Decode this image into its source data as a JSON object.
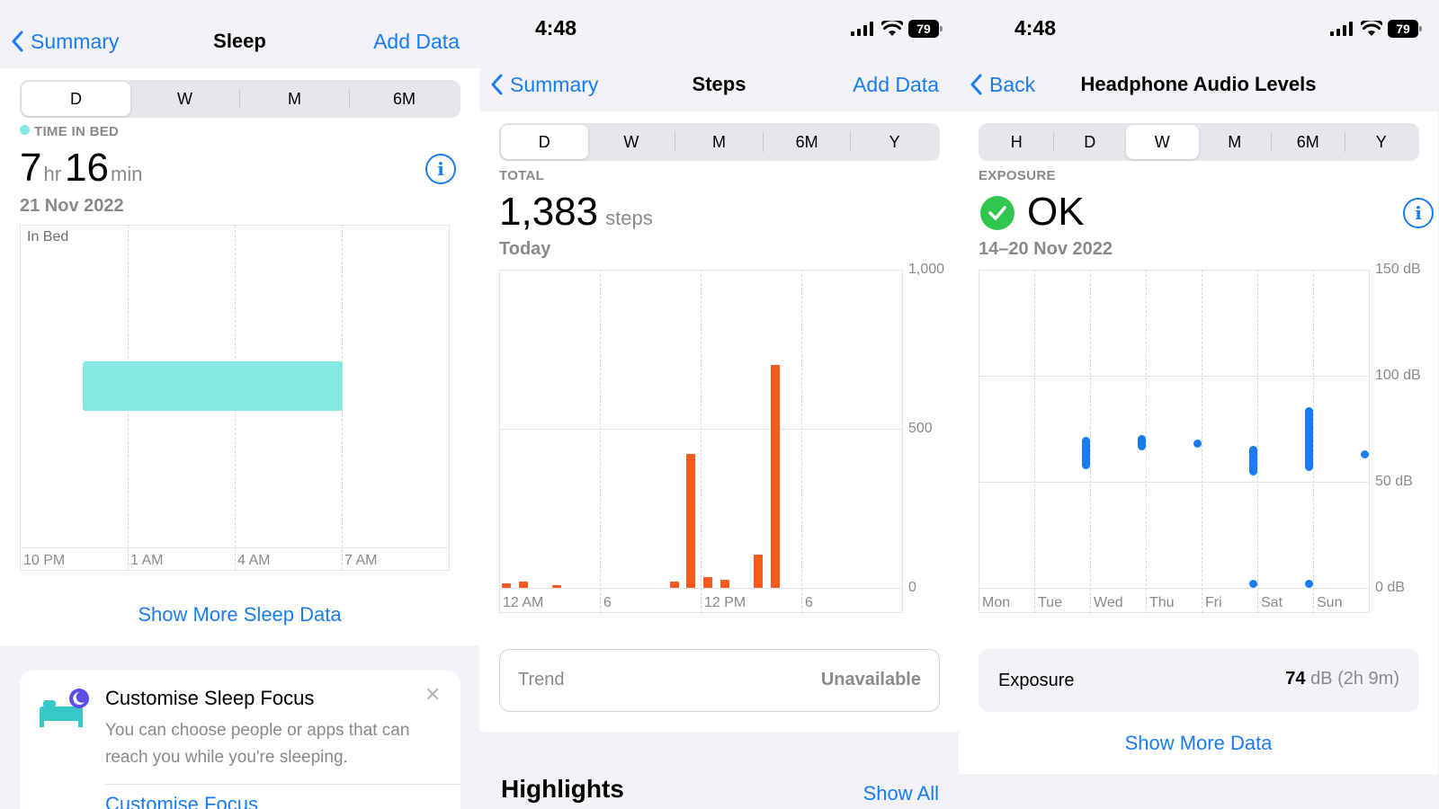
{
  "sleep": {
    "nav": {
      "back": "Summary",
      "title": "Sleep",
      "action": "Add Data"
    },
    "segments": [
      "D",
      "W",
      "M",
      "6M"
    ],
    "selected_segment": "D",
    "legend": "TIME IN BED",
    "duration": {
      "hours": "7",
      "hr_unit": "hr",
      "minutes": "16",
      "min_unit": "min"
    },
    "date": "21 Nov 2022",
    "chart_label": "In Bed",
    "x_ticks": [
      "10 PM",
      "1 AM",
      "4 AM",
      "7 AM"
    ],
    "show_more": "Show More Sleep Data",
    "focus_card": {
      "title": "Customise Sleep Focus",
      "body": "You can choose people or apps that can reach you while you're sleeping.",
      "link": "Customise Focus"
    }
  },
  "steps": {
    "status_time": "4:48",
    "battery": "79",
    "nav": {
      "back": "Summary",
      "title": "Steps",
      "action": "Add Data"
    },
    "segments": [
      "D",
      "W",
      "M",
      "6M",
      "Y"
    ],
    "selected_segment": "D",
    "caption": "TOTAL",
    "total": "1,383",
    "unit": "steps",
    "period": "Today",
    "x_ticks": [
      "12 AM",
      "6",
      "12 PM",
      "6"
    ],
    "y_ticks": [
      "1,000",
      "500",
      "0"
    ],
    "trend_label": "Trend",
    "trend_value": "Unavailable",
    "highlights": "Highlights",
    "show_all": "Show All"
  },
  "headphone": {
    "status_time": "4:48",
    "battery": "79",
    "nav": {
      "back": "Back",
      "title": "Headphone Audio Levels"
    },
    "segments": [
      "H",
      "D",
      "W",
      "M",
      "6M",
      "Y"
    ],
    "selected_segment": "W",
    "caption": "EXPOSURE",
    "status": "OK",
    "date_range": "14–20 Nov 2022",
    "x_ticks": [
      "Mon",
      "Tue",
      "Wed",
      "Thu",
      "Fri",
      "Sat",
      "Sun"
    ],
    "y_ticks": [
      "150 dB",
      "100 dB",
      "50 dB",
      "0 dB"
    ],
    "exposure_label": "Exposure",
    "exposure_value": "74",
    "exposure_unit": "dB (2h 9m)",
    "show_more": "Show More Data"
  },
  "colors": {
    "accent": "#1a7cf5",
    "sleep": "#86e8e3",
    "steps": "#fa5a1e",
    "audio": "#1a7cf5",
    "ok": "#30c74f"
  },
  "chart_data": [
    {
      "type": "bar",
      "title": "Sleep",
      "ylabel": "In Bed",
      "categories": [
        "10 PM",
        "1 AM",
        "4 AM",
        "7 AM"
      ],
      "series": [
        {
          "name": "TIME IN BED",
          "intervals": [
            {
              "start": "11:00 PM",
              "end": "6:16 AM"
            }
          ]
        }
      ]
    },
    {
      "type": "bar",
      "title": "Steps",
      "categories": [
        "12 AM",
        "6",
        "12 PM",
        "6"
      ],
      "ylim": [
        0,
        1000
      ],
      "series": [
        {
          "name": "steps",
          "x_hours": [
            0,
            1,
            3,
            10,
            11,
            12,
            13,
            15,
            16
          ],
          "values": [
            15,
            20,
            7,
            20,
            420,
            35,
            25,
            105,
            700
          ]
        }
      ]
    },
    {
      "type": "bar",
      "title": "Headphone Audio Levels",
      "categories": [
        "Mon",
        "Tue",
        "Wed",
        "Thu",
        "Fri",
        "Sat",
        "Sun"
      ],
      "ylim": [
        0,
        150
      ],
      "series": [
        {
          "name": "Exposure",
          "ranges_db": [
            null,
            [
              56,
              71
            ],
            [
              65,
              72
            ],
            [
              66,
              70
            ],
            [
              [
                53,
                67
              ],
              [
                1,
                4
              ]
            ],
            [
              [
                55,
                85
              ],
              [
                1,
                4
              ]
            ],
            [
              63,
              65
            ]
          ]
        }
      ]
    }
  ]
}
